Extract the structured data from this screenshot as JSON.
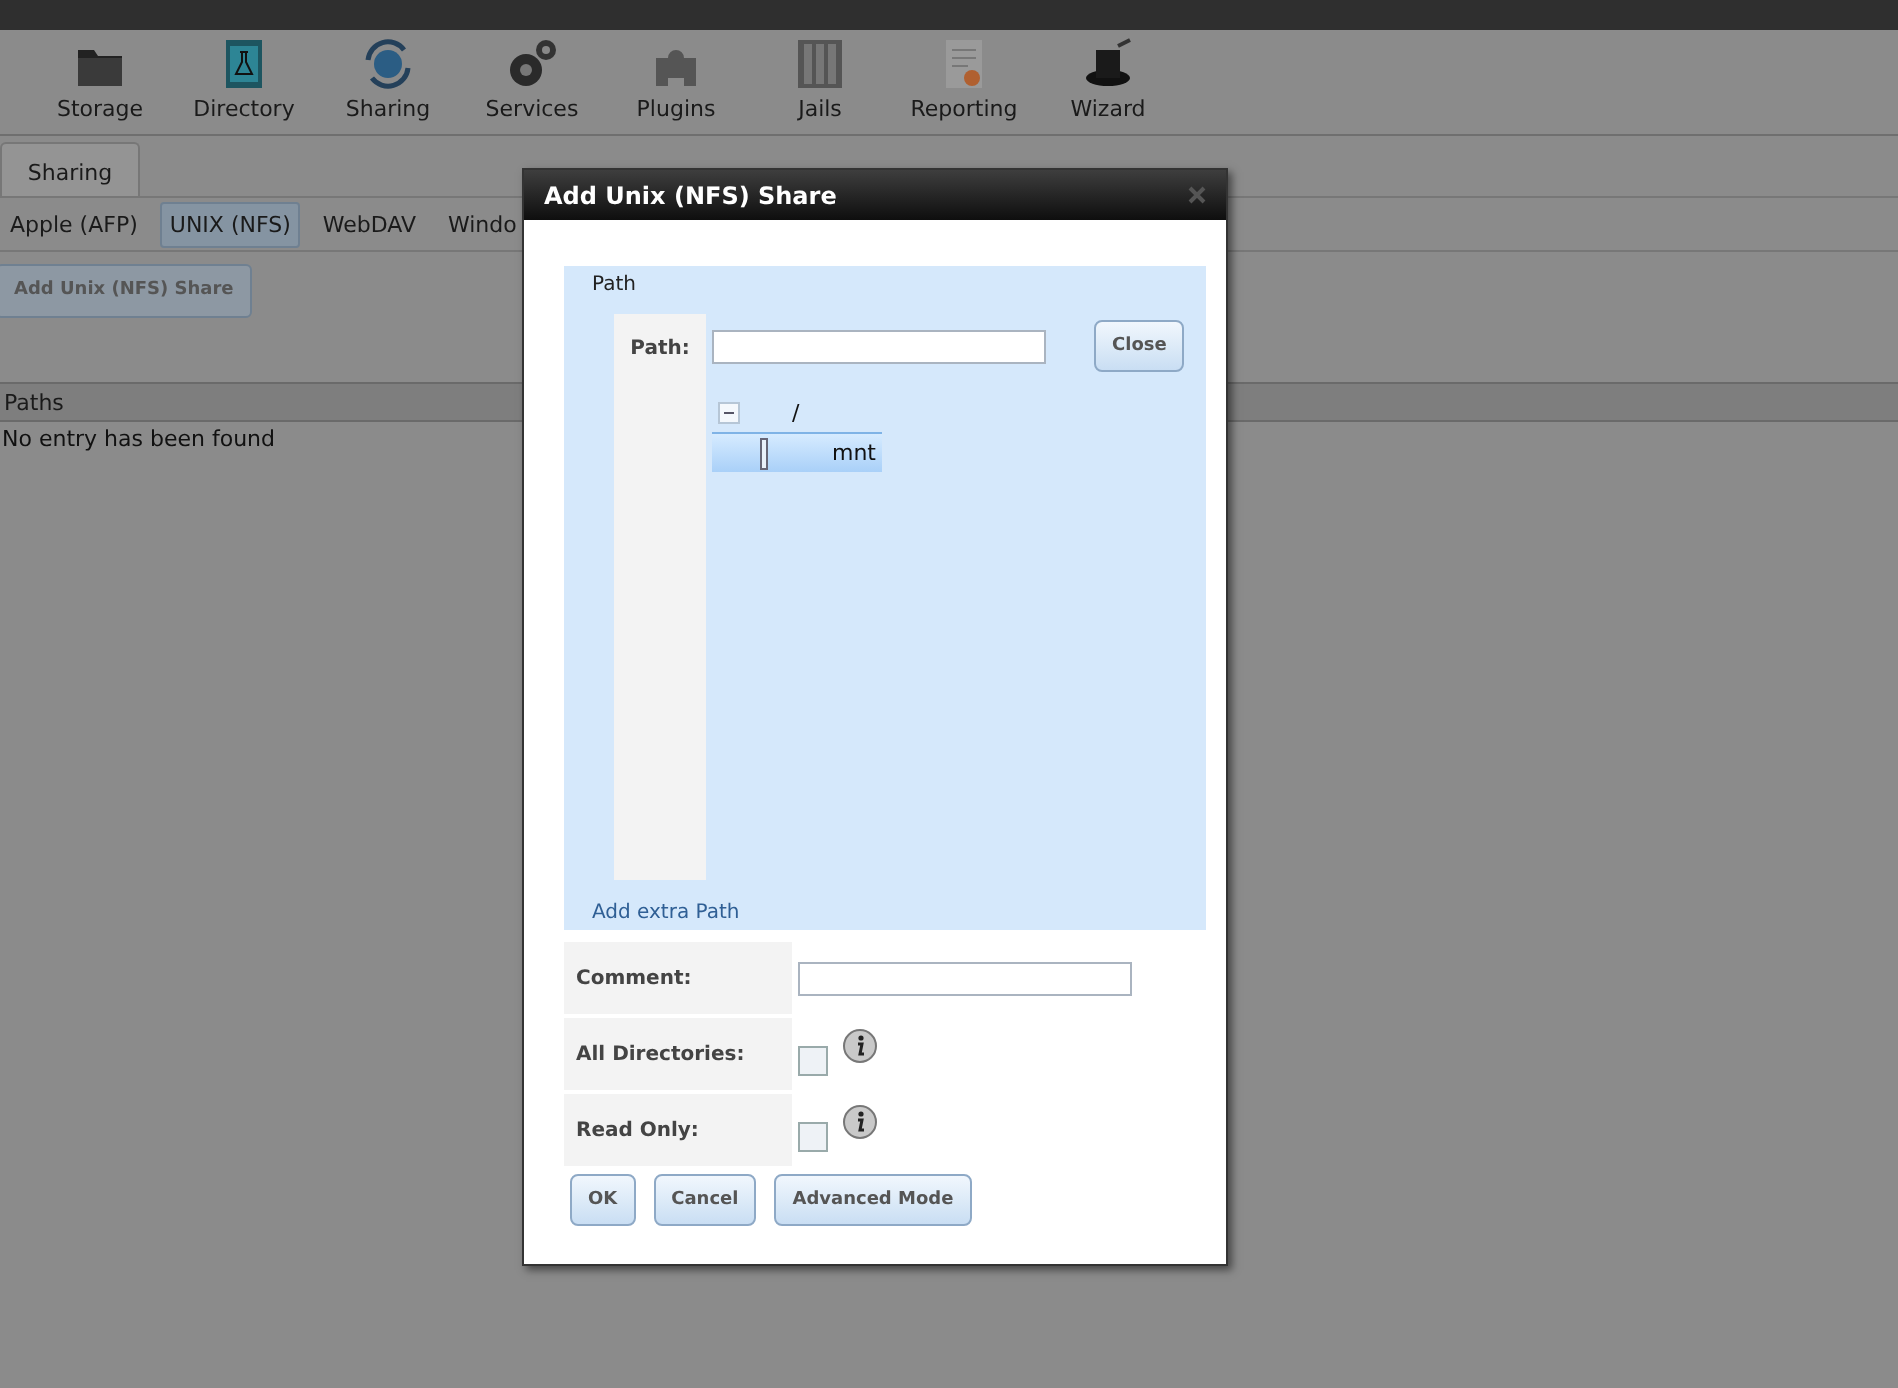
{
  "toolbar": [
    {
      "kind": "storage",
      "label": "Storage"
    },
    {
      "kind": "directory",
      "label": "Directory"
    },
    {
      "kind": "sharing",
      "label": "Sharing"
    },
    {
      "kind": "services",
      "label": "Services"
    },
    {
      "kind": "plugins",
      "label": "Plugins"
    },
    {
      "kind": "jails",
      "label": "Jails"
    },
    {
      "kind": "reporting",
      "label": "Reporting"
    },
    {
      "kind": "wizard",
      "label": "Wizard"
    }
  ],
  "tabs": [
    {
      "label": "Sharing",
      "selected": true
    }
  ],
  "subtabs": [
    {
      "label": "Apple (AFP)",
      "selected": false
    },
    {
      "label": "UNIX (NFS)",
      "selected": true
    },
    {
      "label": "WebDAV",
      "selected": false
    },
    {
      "label": "Windo",
      "selected": false
    }
  ],
  "add_button": "Add Unix (NFS) Share",
  "table": {
    "columns": [
      "Paths"
    ],
    "empty_message": "No entry has been found"
  },
  "dialog": {
    "title": "Add Unix (NFS) Share",
    "path_section": {
      "legend": "Path",
      "label": "Path:",
      "close_button": "Close",
      "tree": [
        {
          "label": "/",
          "expanded": true,
          "children": [
            {
              "label": "mnt",
              "selected": true
            }
          ]
        }
      ],
      "add_extra": "Add extra Path"
    },
    "fields": [
      {
        "kind": "text",
        "label": "Comment:"
      },
      {
        "kind": "checkbox",
        "label": "All Directories:",
        "checked": false,
        "info": true
      },
      {
        "kind": "checkbox",
        "label": "Read Only:",
        "checked": false,
        "info": true
      }
    ],
    "buttons": [
      "OK",
      "Cancel",
      "Advanced Mode"
    ]
  }
}
